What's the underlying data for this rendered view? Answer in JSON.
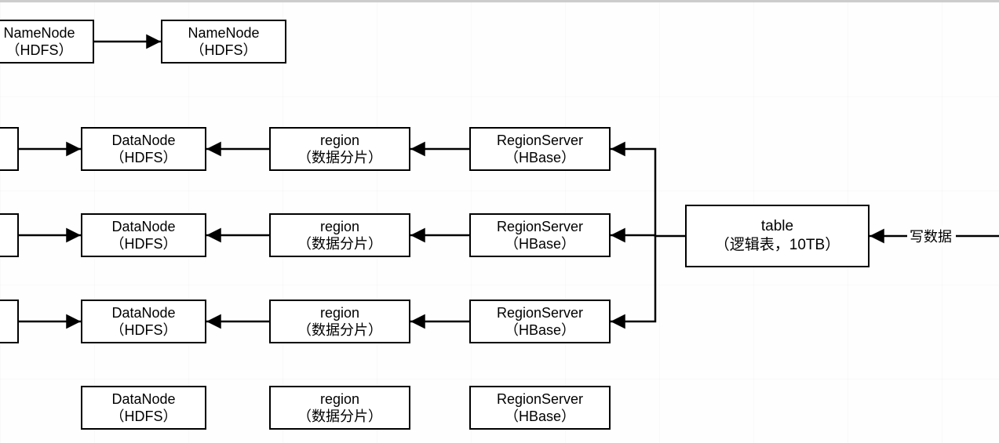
{
  "nodes": {
    "nn0": {
      "line1": "NameNode",
      "line2": "（HDFS）"
    },
    "nn1": {
      "line1": "NameNode",
      "line2": "（HDFS）"
    },
    "dn1": {
      "line1": "DataNode",
      "line2": "（HDFS）"
    },
    "dn2": {
      "line1": "DataNode",
      "line2": "（HDFS）"
    },
    "dn3": {
      "line1": "DataNode",
      "line2": "（HDFS）"
    },
    "dn4": {
      "line1": "DataNode",
      "line2": "（HDFS）"
    },
    "rg1": {
      "line1": "region",
      "line2": "（数据分片）"
    },
    "rg2": {
      "line1": "region",
      "line2": "（数据分片）"
    },
    "rg3": {
      "line1": "region",
      "line2": "（数据分片）"
    },
    "rg4": {
      "line1": "region",
      "line2": "（数据分片）"
    },
    "rs1": {
      "line1": "RegionServer",
      "line2": "（HBase）"
    },
    "rs2": {
      "line1": "RegionServer",
      "line2": "（HBase）"
    },
    "rs3": {
      "line1": "RegionServer",
      "line2": "（HBase）"
    },
    "rs4": {
      "line1": "RegionServer",
      "line2": "（HBase）"
    },
    "table": {
      "line1": "table",
      "line2": "（逻辑表，10TB）"
    }
  },
  "edgeLabels": {
    "write": "写数据"
  }
}
